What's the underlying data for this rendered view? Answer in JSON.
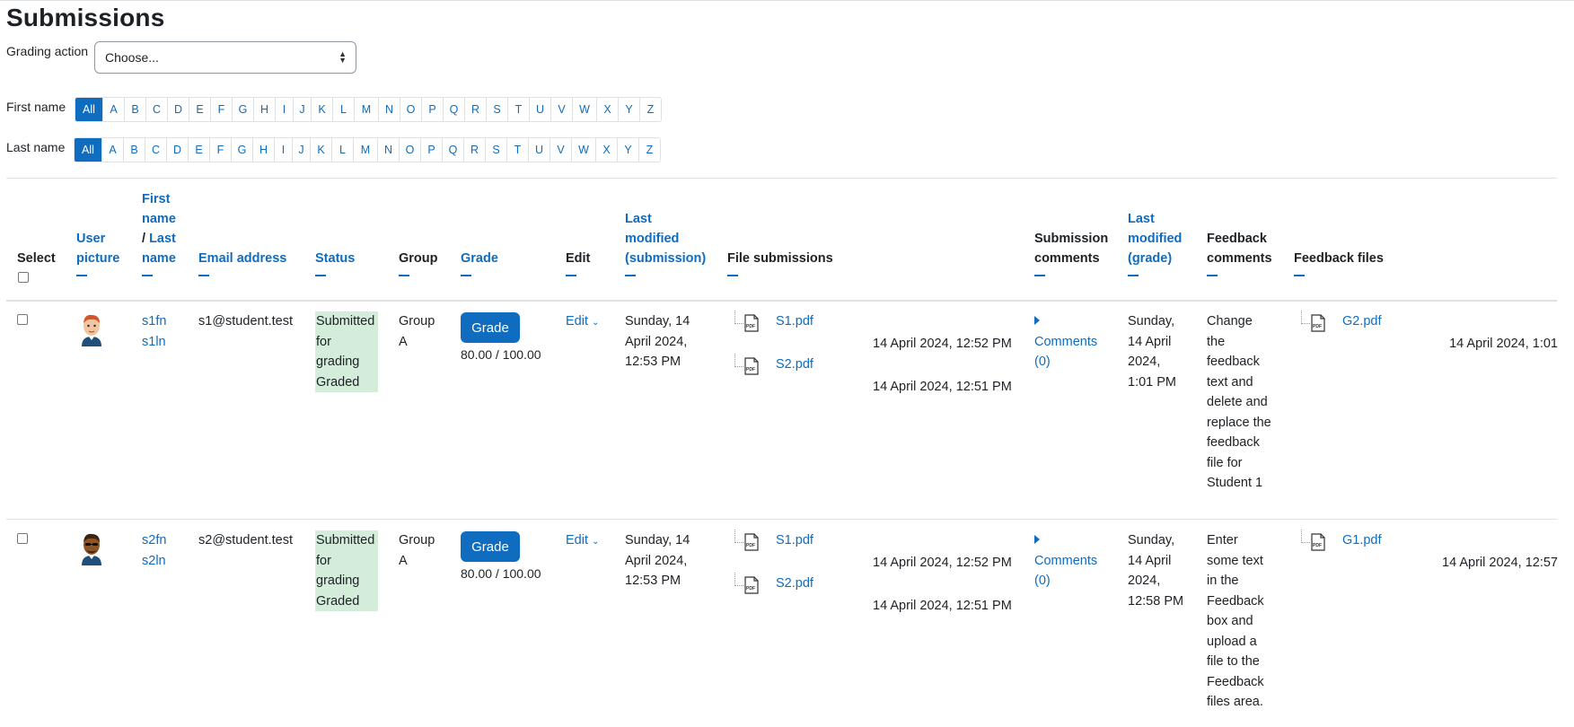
{
  "page": {
    "title": "Submissions"
  },
  "grading": {
    "label": "Grading action",
    "value": "Choose..."
  },
  "filters": {
    "first_label": "First name",
    "last_label": "Last name",
    "all": "All",
    "letters": [
      "A",
      "B",
      "C",
      "D",
      "E",
      "F",
      "G",
      "H",
      "I",
      "J",
      "K",
      "L",
      "M",
      "N",
      "O",
      "P",
      "Q",
      "R",
      "S",
      "T",
      "U",
      "V",
      "W",
      "X",
      "Y",
      "Z"
    ]
  },
  "headers": {
    "select": "Select",
    "user_picture_1": "User",
    "user_picture_2": "picture",
    "name_1": "First",
    "name_2": "name",
    "name_3a": "/ ",
    "name_3b": "Last",
    "name_4": "name",
    "email": "Email address",
    "status": "Status",
    "group": "Group",
    "grade": "Grade",
    "edit": "Edit",
    "lastmod_1": "Last",
    "lastmod_2": "modified",
    "lastmod_3": "(submission)",
    "file_submissions": "File submissions",
    "sub_comments_1": "Submission",
    "sub_comments_2": "comments",
    "lastmodg_1": "Last",
    "lastmodg_2": "modified",
    "lastmodg_3": "(grade)",
    "feedback_comments_1": "Feedback",
    "feedback_comments_2": "comments",
    "feedback_files": "Feedback files"
  },
  "rows": [
    {
      "first": "s1fn",
      "last": "s1ln",
      "email": "s1@student.test",
      "status": [
        "Submitted",
        "for",
        "grading",
        "Graded"
      ],
      "group": [
        "Group",
        "A"
      ],
      "grade_button": "Grade",
      "grade": "80.00 / 100.00",
      "edit": "Edit",
      "lastmod": [
        "Sunday, 14",
        "April 2024,",
        "12:53 PM"
      ],
      "files": [
        {
          "name": "S1.pdf",
          "date": "14 April 2024, 12:52 PM"
        },
        {
          "name": "S2.pdf",
          "date": "14 April 2024, 12:51 PM"
        }
      ],
      "comments": [
        "Comments",
        "(0)"
      ],
      "lastmod_grade": [
        "Sunday,",
        "14 April",
        "2024,",
        "1:01 PM"
      ],
      "feedback": [
        "Change",
        "the",
        "feedback",
        "text and",
        "delete and",
        "replace the",
        "feedback",
        "file for",
        "Student 1"
      ],
      "feedback_file": "G2.pdf",
      "feedback_file_date": "14 April 2024, 1:01"
    },
    {
      "first": "s2fn",
      "last": "s2ln",
      "email": "s2@student.test",
      "status": [
        "Submitted",
        "for",
        "grading",
        "Graded"
      ],
      "group": [
        "Group",
        "A"
      ],
      "grade_button": "Grade",
      "grade": "80.00 / 100.00",
      "edit": "Edit",
      "lastmod": [
        "Sunday, 14",
        "April 2024,",
        "12:53 PM"
      ],
      "files": [
        {
          "name": "S1.pdf",
          "date": "14 April 2024, 12:52 PM"
        },
        {
          "name": "S2.pdf",
          "date": "14 April 2024, 12:51 PM"
        }
      ],
      "comments": [
        "Comments",
        "(0)"
      ],
      "lastmod_grade": [
        "Sunday,",
        "14 April",
        "2024,",
        "12:58 PM"
      ],
      "feedback": [
        "Enter",
        "some text",
        "in the",
        "Feedback",
        "box and",
        "upload a",
        "file to the",
        "Feedback",
        "files area."
      ],
      "feedback_file": "G1.pdf",
      "feedback_file_date": "14 April 2024, 12:57"
    }
  ],
  "colors": {
    "accent": "#0f6cbf",
    "status_bg": "#d4edda"
  }
}
